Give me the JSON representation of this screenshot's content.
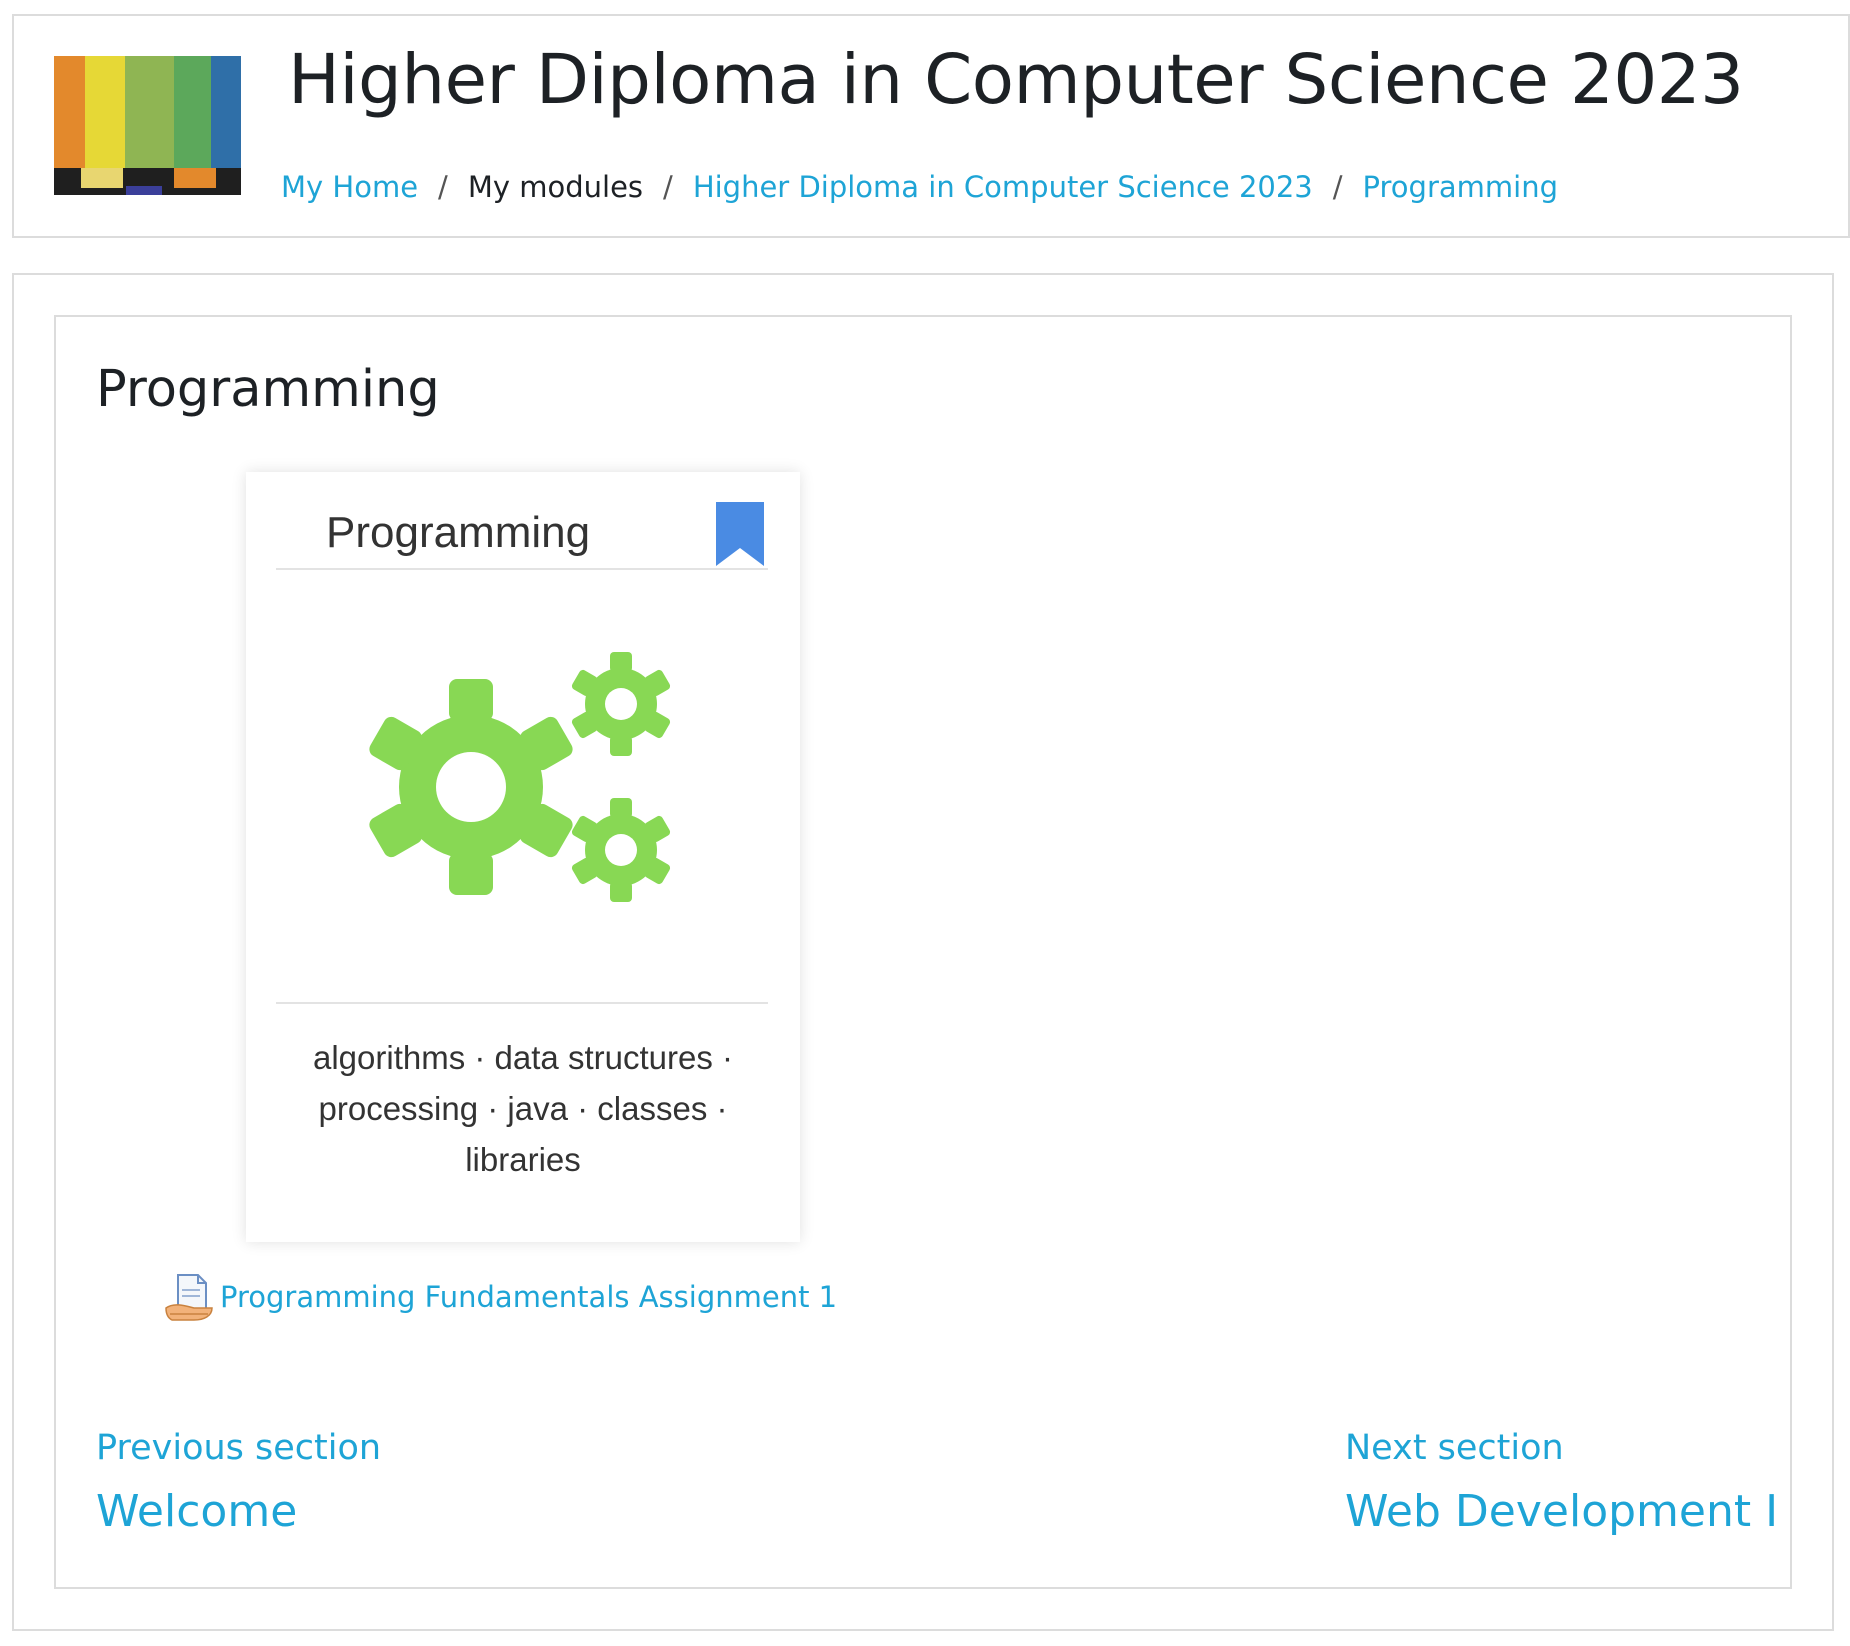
{
  "header": {
    "course_title": "Higher Diploma in Computer Science 2023",
    "breadcrumb": [
      {
        "label": "My Home"
      },
      {
        "label": "My modules"
      },
      {
        "label": "Higher Diploma in Computer Science 2023"
      },
      {
        "label": "Programming"
      }
    ],
    "separator": "/"
  },
  "section": {
    "title": "Programming",
    "card": {
      "title": "Programming",
      "tags": "algorithms · data structures · processing · java · classes · libraries",
      "bookmark_icon": "bookmark-icon",
      "image_icon": "gears-icon"
    },
    "activities": [
      {
        "label": "Programming Fundamentals Assignment 1",
        "icon": "assignment-icon"
      }
    ]
  },
  "navigation": {
    "previous": {
      "label": "Previous section",
      "title": "Welcome"
    },
    "next": {
      "label": "Next section",
      "title": "Web Development I"
    }
  },
  "colors": {
    "link": "#1ea4d6",
    "gear": "#88d854",
    "bookmark": "#4a8be3",
    "border": "#dcdcdc"
  }
}
